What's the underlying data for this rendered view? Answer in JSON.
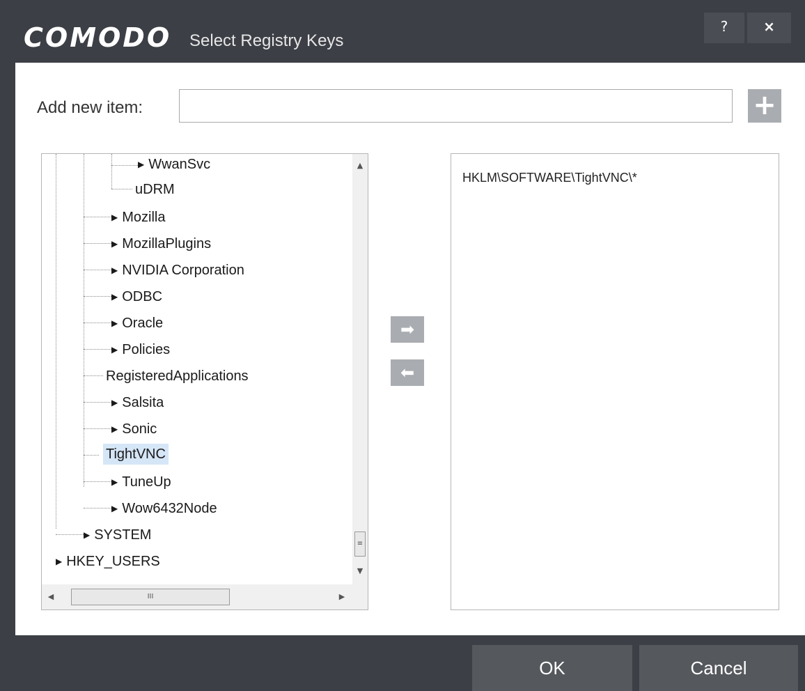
{
  "window": {
    "brand": "COMODO",
    "title": "Select Registry Keys",
    "help_label": "?",
    "close_label": "×"
  },
  "add_item": {
    "label": "Add new item:",
    "value": "",
    "add_button": "+"
  },
  "tree": {
    "items": [
      {
        "label": "WwanSvc",
        "expandable": true
      },
      {
        "label": "uDRM",
        "expandable": false
      },
      {
        "label": "Mozilla",
        "expandable": true
      },
      {
        "label": "MozillaPlugins",
        "expandable": true
      },
      {
        "label": "NVIDIA Corporation",
        "expandable": true
      },
      {
        "label": "ODBC",
        "expandable": true
      },
      {
        "label": "Oracle",
        "expandable": true
      },
      {
        "label": "Policies",
        "expandable": true
      },
      {
        "label": "RegisteredApplications",
        "expandable": false
      },
      {
        "label": "Salsita",
        "expandable": true
      },
      {
        "label": "Sonic",
        "expandable": true
      },
      {
        "label": "TightVNC",
        "expandable": false,
        "selected": true
      },
      {
        "label": "TuneUp",
        "expandable": true
      },
      {
        "label": "Wow6432Node",
        "expandable": true
      },
      {
        "label": "SYSTEM",
        "expandable": true
      },
      {
        "label": "HKEY_USERS",
        "expandable": true
      }
    ]
  },
  "move_buttons": {
    "add_arrow": "➡",
    "remove_arrow": "⬅"
  },
  "selected_list": {
    "items": [
      "HKLM\\SOFTWARE\\TightVNC\\*"
    ]
  },
  "footer": {
    "ok_label": "OK",
    "cancel_label": "Cancel"
  },
  "colors": {
    "chrome": "#3c3f45",
    "button": "#55585d",
    "selection": "#d5e6f7"
  }
}
